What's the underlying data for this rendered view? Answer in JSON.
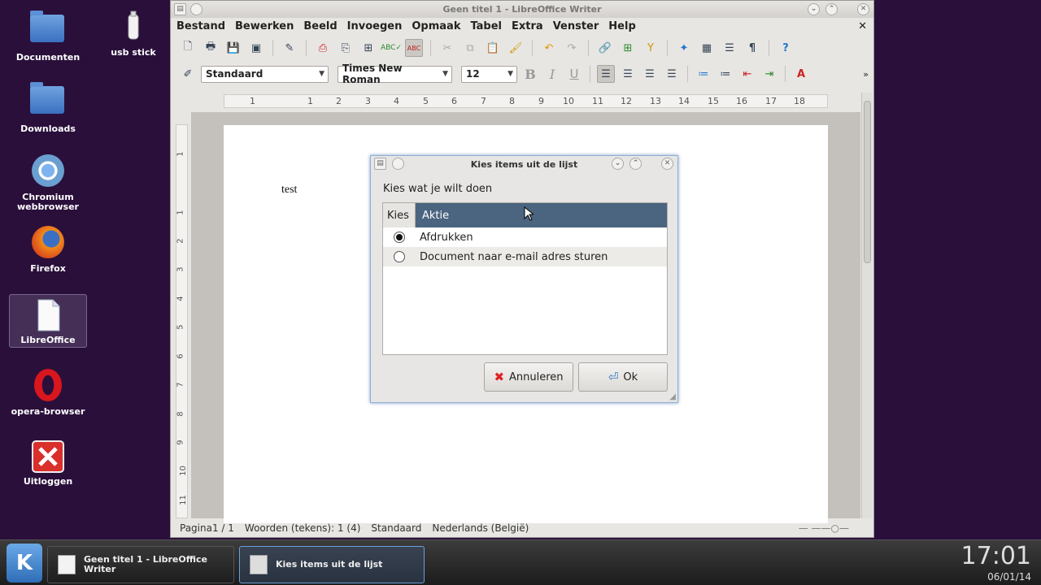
{
  "desktop": {
    "icons": [
      {
        "label": "Documenten",
        "icon": "folder-icon"
      },
      {
        "label": "usb stick",
        "icon": "usb-drive-icon"
      },
      {
        "label": "Downloads",
        "icon": "folder-icon"
      },
      {
        "label": "Chromium webbrowser",
        "icon": "chromium-icon"
      },
      {
        "label": "Firefox",
        "icon": "firefox-icon"
      },
      {
        "label": "LibreOffice",
        "icon": "libreoffice-icon"
      },
      {
        "label": "opera-browser",
        "icon": "opera-icon"
      },
      {
        "label": "Uitloggen",
        "icon": "logout-icon"
      }
    ]
  },
  "writer": {
    "title": "Geen titel 1 - LibreOffice Writer",
    "menu": [
      "Bestand",
      "Bewerken",
      "Beeld",
      "Invoegen",
      "Opmaak",
      "Tabel",
      "Extra",
      "Venster",
      "Help"
    ],
    "style_value": "Standaard",
    "font_value": "Times New Roman",
    "size_value": "12",
    "ruler_h": [
      "1",
      "1",
      "2",
      "3",
      "4",
      "5",
      "6",
      "7",
      "8",
      "9",
      "10",
      "11",
      "12",
      "13",
      "14",
      "15",
      "16",
      "17",
      "18"
    ],
    "ruler_v": [
      "1",
      "1",
      "2",
      "3",
      "4",
      "5",
      "6",
      "7",
      "8",
      "9",
      "10",
      "11"
    ],
    "doc_text": "test",
    "status": {
      "page": "Pagina1 / 1",
      "words": "Woorden (tekens): 1 (4)",
      "style": "Standaard",
      "language": "Nederlands (België)"
    }
  },
  "dialog": {
    "title": "Kies items uit de lijst",
    "prompt": "Kies wat je wilt doen",
    "col_kies": "Kies",
    "col_aktie": "Aktie",
    "rows": [
      {
        "label": "Afdrukken",
        "selected": true
      },
      {
        "label": "Document naar e-mail adres sturen",
        "selected": false
      }
    ],
    "cancel_label": "Annuleren",
    "ok_label": "Ok"
  },
  "taskbar": {
    "task1": "Geen titel 1 - LibreOffice Writer",
    "task2": "Kies items uit de lijst",
    "time": "17:01",
    "date": "06/01/14"
  },
  "colors": {
    "desktop_bg": "#2a0f3b",
    "list_header": "#4b6480",
    "dialog_border": "#8fb0d6"
  }
}
